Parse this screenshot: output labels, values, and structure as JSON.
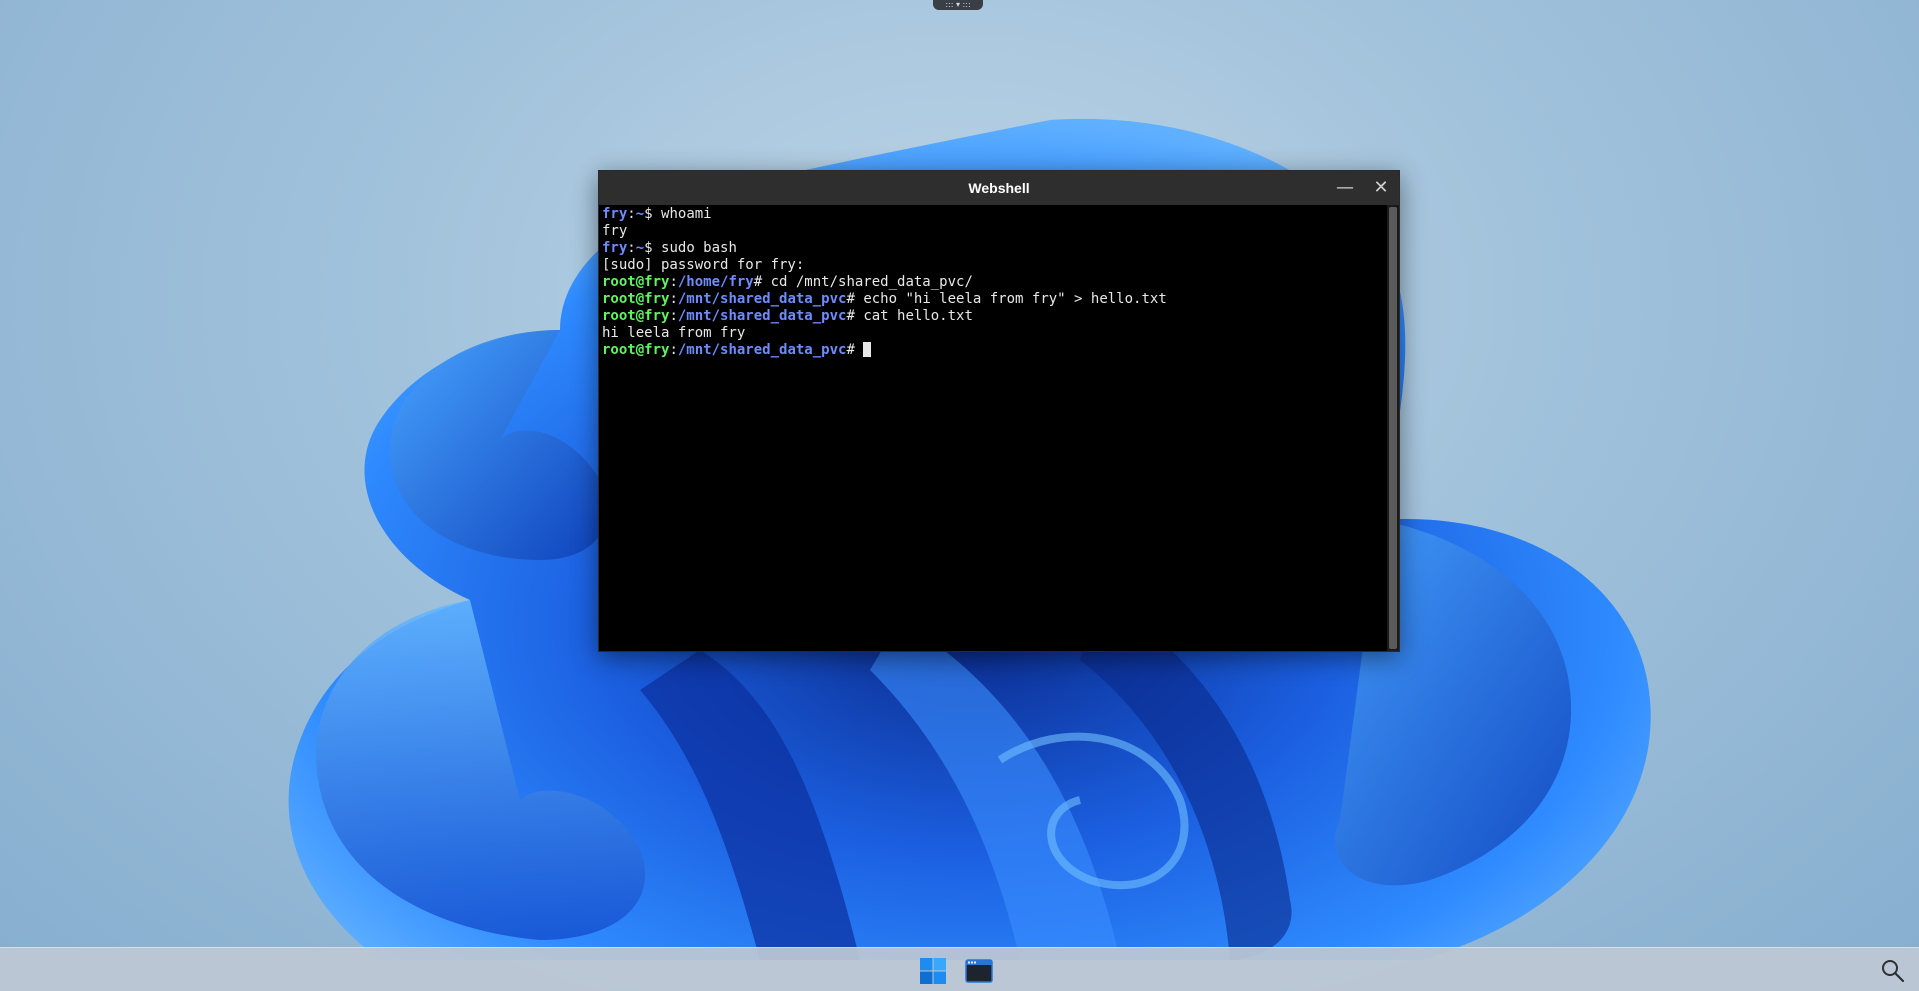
{
  "desktop": {
    "top_handle_glyphs": "::: ▾ :::"
  },
  "window": {
    "title": "Webshell",
    "minimize_glyph": "—",
    "close_glyph": "✕"
  },
  "terminal": {
    "lines": [
      {
        "user": "fry",
        "sep": ":",
        "path": "~",
        "prompt": "$ ",
        "cmd": "whoami",
        "user_style": "blue"
      },
      {
        "out": "fry"
      },
      {
        "user": "fry",
        "sep": ":",
        "path": "~",
        "prompt": "$ ",
        "cmd": "sudo bash",
        "user_style": "blue"
      },
      {
        "out": "[sudo] password for fry:"
      },
      {
        "user": "root@fry",
        "sep": ":",
        "path": "/home/fry",
        "prompt": "# ",
        "cmd": "cd /mnt/shared_data_pvc/",
        "user_style": "green"
      },
      {
        "user": "root@fry",
        "sep": ":",
        "path": "/mnt/shared_data_pvc",
        "prompt": "# ",
        "cmd": "echo \"hi leela from fry\" > hello.txt",
        "user_style": "green"
      },
      {
        "user": "root@fry",
        "sep": ":",
        "path": "/mnt/shared_data_pvc",
        "prompt": "# ",
        "cmd": "cat hello.txt",
        "user_style": "green"
      },
      {
        "out": "hi leela from fry"
      },
      {
        "user": "root@fry",
        "sep": ":",
        "path": "/mnt/shared_data_pvc",
        "prompt": "# ",
        "cmd": "",
        "user_style": "green",
        "cursor": true
      }
    ]
  },
  "taskbar": {
    "icons": [
      "windows-start-icon",
      "terminal-app-icon",
      "search-icon"
    ]
  },
  "colors": {
    "prompt_user_green": "#5ff55f",
    "prompt_path_blue": "#6f8cff",
    "terminal_bg": "#000000",
    "titlebar_bg": "#2e2e2e"
  }
}
